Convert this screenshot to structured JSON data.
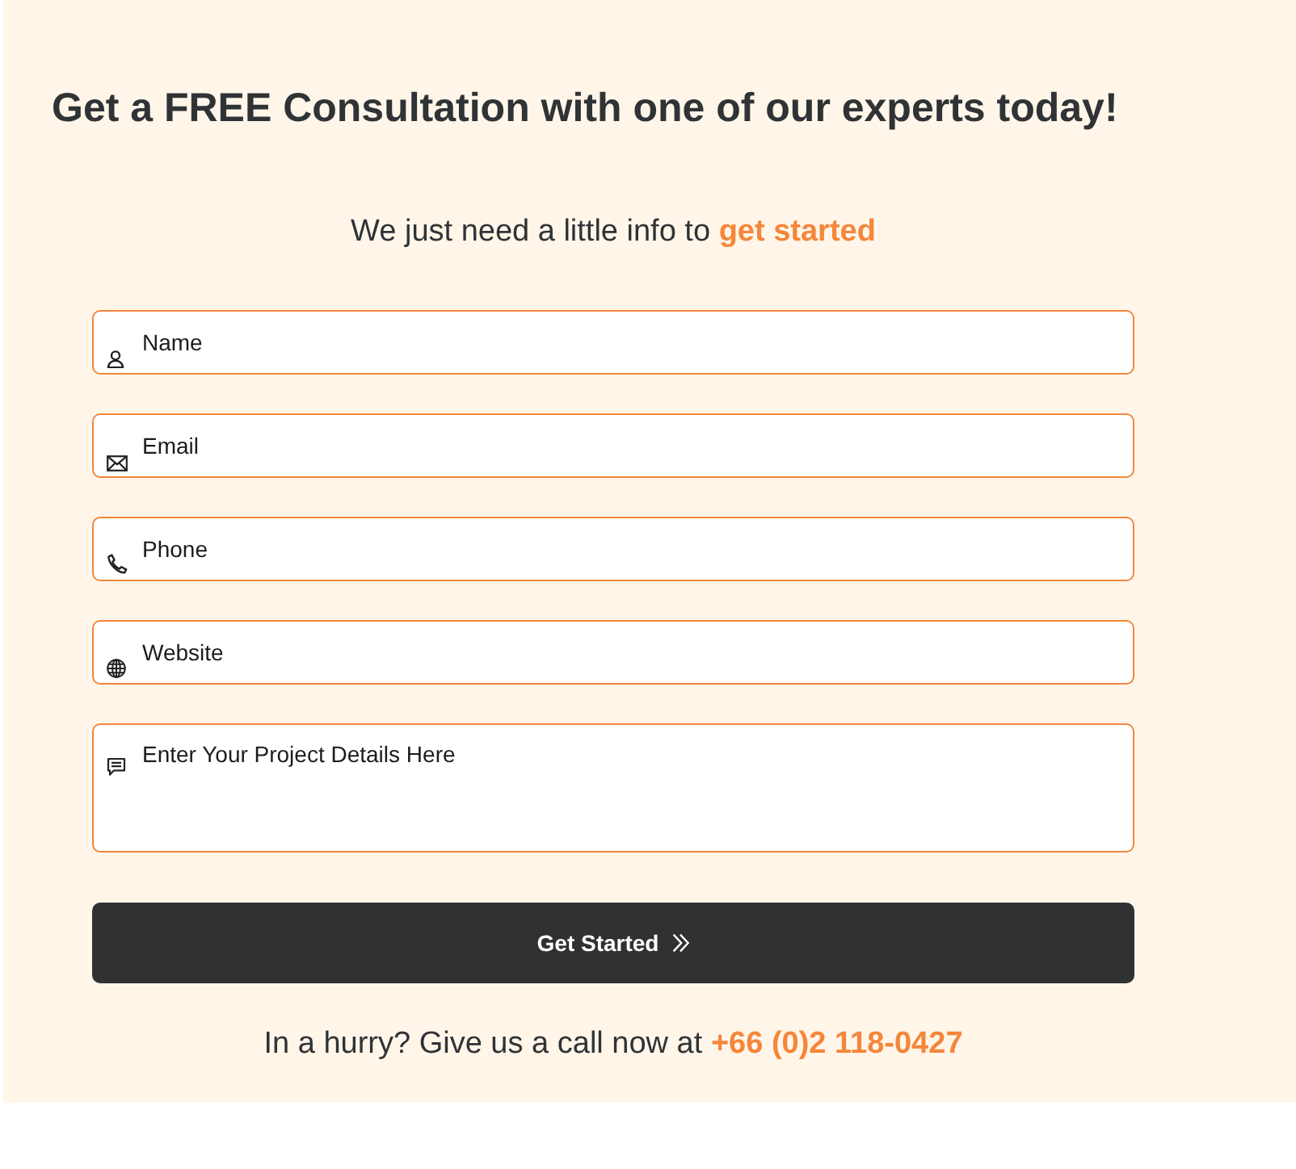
{
  "heading": "Get a FREE Consultation with one of our experts today!",
  "intro": "We just need a little info to **get started**",
  "fields": [
    {
      "kind": "name",
      "placeholder": "Name"
    },
    {
      "kind": "email",
      "placeholder": "Email"
    },
    {
      "kind": "phone",
      "placeholder": "Phone"
    },
    {
      "kind": "website",
      "placeholder": "Website"
    },
    {
      "kind": "details",
      "placeholder": "Enter Your Project Details Here"
    }
  ],
  "submit_button": {
    "label": "Get Started"
  },
  "call_note": {
    "text": "In a hurry? Give us a call now at",
    "phone": "+66 (0)2 118-0427"
  }
}
